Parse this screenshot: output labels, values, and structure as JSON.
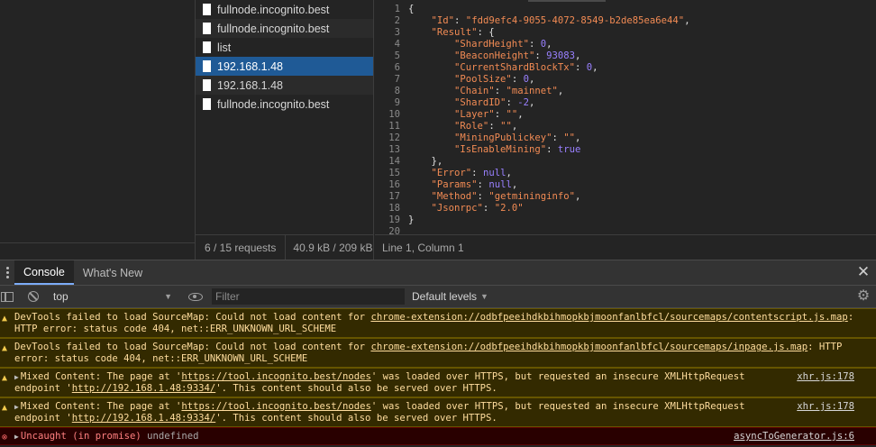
{
  "requests": {
    "rows": [
      {
        "name": "fullnode.incognito.best"
      },
      {
        "name": "fullnode.incognito.best"
      },
      {
        "name": "list"
      },
      {
        "name": "192.168.1.48"
      },
      {
        "name": "192.168.1.48"
      },
      {
        "name": "fullnode.incognito.best"
      }
    ],
    "selected_index": 3,
    "count_text": "6 / 15 requests",
    "size_text": "40.9 kB / 209 kB"
  },
  "response": {
    "line_numbers": [
      "1",
      "2",
      "3",
      "4",
      "5",
      "6",
      "7",
      "8",
      "9",
      "10",
      "11",
      "12",
      "13",
      "14",
      "15",
      "16",
      "17",
      "18",
      "19",
      "20"
    ],
    "json": {
      "Id": "fdd9efc4-9055-4072-8549-b2de85ea6e44",
      "Result": {
        "ShardHeight": "0",
        "BeaconHeight": "93083",
        "CurrentShardBlockTx": "0",
        "PoolSize": "0",
        "Chain": "mainnet",
        "ShardID": "-2",
        "Layer": "",
        "Role": "",
        "MiningPublickey": "",
        "IsEnableMining": "true"
      },
      "Error": "null",
      "Params": "null",
      "Method": "getmininginfo",
      "Jsonrpc": "2.0"
    },
    "cursor_text": "Line 1, Column 1"
  },
  "drawer": {
    "tabs": [
      {
        "label": "Console",
        "active": true
      },
      {
        "label": "What's New",
        "active": false
      }
    ]
  },
  "console_toolbar": {
    "context": "top",
    "filter_placeholder": "Filter",
    "levels": "Default levels"
  },
  "messages": [
    {
      "level": "warning",
      "text_before": "DevTools failed to load SourceMap: Could not load content for ",
      "link": "chrome-extension://odbfpeeihdkbihmopkbjmoonfanlbfcl/sourcemaps/contentscript.js.map",
      "text_after": ": HTTP error: status code 404, net::ERR_UNKNOWN_URL_SCHEME"
    },
    {
      "level": "warning",
      "text_before": "DevTools failed to load SourceMap: Could not load content for ",
      "link": "chrome-extension://odbfpeeihdkbihmopkbjmoonfanlbfcl/sourcemaps/inpage.js.map",
      "text_after": ": HTTP error: status code 404, net::ERR_UNKNOWN_URL_SCHEME"
    },
    {
      "level": "warning",
      "prefix": "Mixed Content: The page at '",
      "page_url": "https://tool.incognito.best/nodes",
      "middle": "' was loaded over HTTPS, but requested an insecure XMLHttpRequest endpoint '",
      "endpoint": "http://192.168.1.48:9334/",
      "suffix": "'. This content should also be served over HTTPS.",
      "source": "xhr.js:178"
    },
    {
      "level": "warning",
      "prefix": "Mixed Content: The page at '",
      "page_url": "https://tool.incognito.best/nodes",
      "middle": "' was loaded over HTTPS, but requested an insecure XMLHttpRequest endpoint '",
      "endpoint": "http://192.168.1.48:9334/",
      "suffix": "'. This content should also be served over HTTPS.",
      "source": "xhr.js:178"
    },
    {
      "level": "error",
      "text": "Uncaught (in promise)",
      "value": "undefined",
      "source": "asyncToGenerator.js:6"
    }
  ]
}
